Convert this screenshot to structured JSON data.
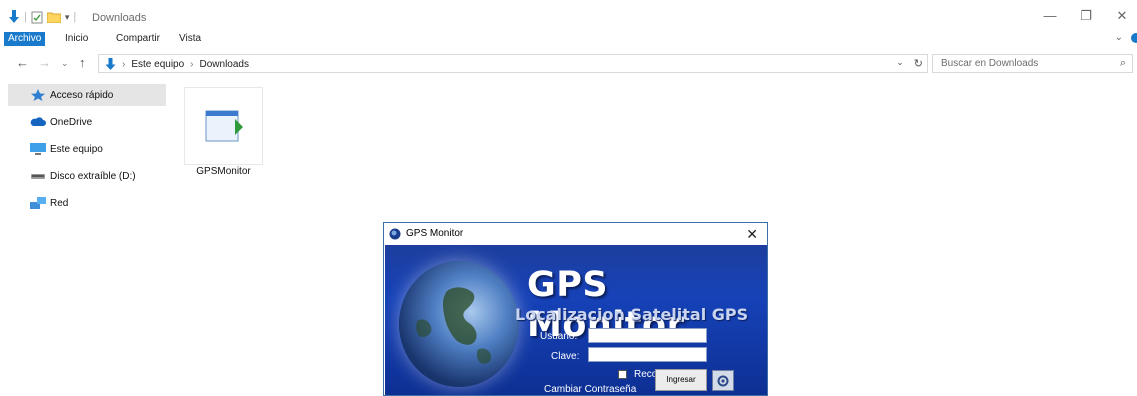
{
  "window": {
    "title": "Downloads",
    "minimize": "—",
    "restore": "❐",
    "close": "✕"
  },
  "ribbon": {
    "tabs": [
      "Archivo",
      "Inicio",
      "Compartir",
      "Vista"
    ]
  },
  "address": {
    "crumbs": [
      "Este equipo",
      "Downloads"
    ],
    "search_placeholder": "Buscar en Downloads"
  },
  "navpane": {
    "items": [
      {
        "label": "Acceso rápido",
        "icon": "star-icon"
      },
      {
        "label": "OneDrive",
        "icon": "cloud-icon"
      },
      {
        "label": "Este equipo",
        "icon": "computer-icon"
      },
      {
        "label": "Disco extraíble (D:)",
        "icon": "drive-icon"
      },
      {
        "label": "Red",
        "icon": "network-icon"
      }
    ]
  },
  "files": [
    {
      "name": "GPSMonitor",
      "icon": "application-icon"
    }
  ],
  "dialog": {
    "title": "GPS Monitor",
    "heading": "GPS Monitor",
    "subheading": "Localizacion Satelital GPS",
    "user_label": "Usuario:",
    "user_value": "",
    "password_label": "Clave:",
    "password_value": "",
    "remember_label": "Recordar",
    "change_password_label": "Cambiar Contraseña",
    "login_button": "Ingresar"
  },
  "colors": {
    "accent": "#1979ca",
    "dialog_bg": "#1642b8",
    "selection": "#e5e5e5"
  }
}
